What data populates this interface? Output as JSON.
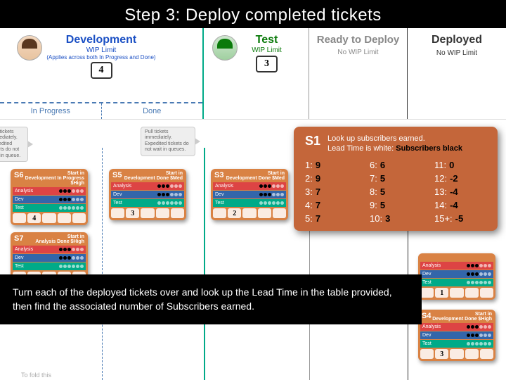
{
  "title": "Step 3: Deploy completed tickets",
  "columns": {
    "dev": {
      "title": "Development",
      "wip_label": "WIP Limit",
      "wip_sub": "(Applies across both In Progress and Done)",
      "wip_value": "4",
      "sub_left": "In Progress",
      "sub_right": "Done"
    },
    "test": {
      "title": "Test",
      "wip_label": "WIP Limit",
      "wip_value": "3"
    },
    "ready": {
      "title": "Ready to Deploy",
      "no_wip": "No WIP Limit"
    },
    "deployed": {
      "title": "Deployed",
      "no_wip": "No WIP Limit"
    }
  },
  "hints": {
    "left": "Pull tickets immediately. Expedited tickets do not wait in queue.",
    "mid": "Pull tickets immediately. Expedited tickets do not wait in queues."
  },
  "tickets": {
    "s6": {
      "id": "S6",
      "meta_top": "Start in",
      "meta_loc": "Development In Progress",
      "price": "$High",
      "footer": [
        "",
        "4",
        "",
        "",
        ""
      ]
    },
    "s7": {
      "id": "S7",
      "meta_top": "Start in",
      "meta_loc": "Analysis Done",
      "price": "$High",
      "footer": [
        "",
        "",
        "",
        "",
        ""
      ]
    },
    "s5": {
      "id": "S5",
      "meta_top": "Start in",
      "meta_loc": "Development Done",
      "price": "$Med",
      "footer": [
        "",
        "3",
        "",
        "",
        ""
      ]
    },
    "s3": {
      "id": "S3",
      "meta_top": "Start in",
      "meta_loc": "Development Done",
      "price": "$Med",
      "footer": [
        "",
        "2",
        "",
        "",
        ""
      ]
    },
    "s_deploy1": {
      "id": "",
      "meta_loc": "",
      "price": "",
      "footer": [
        "",
        "1",
        "",
        "",
        ""
      ]
    },
    "s4": {
      "id": "S4",
      "meta_top": "Start in",
      "meta_loc": "Development Done",
      "price": "$High",
      "footer": [
        "",
        "3",
        "",
        "",
        ""
      ]
    }
  },
  "row_labels": {
    "analysis": "Analysis",
    "dev": "Dev",
    "test": "Test"
  },
  "lookup": {
    "id": "S1",
    "line1": "Look up subscribers earned.",
    "line2_a": "Lead Time is white: ",
    "line2_b": "Subscribers black",
    "rows": [
      {
        "k": "1:",
        "v": "9"
      },
      {
        "k": "6:",
        "v": "6"
      },
      {
        "k": "11:",
        "v": "0"
      },
      {
        "k": "2:",
        "v": "9"
      },
      {
        "k": "7:",
        "v": "5"
      },
      {
        "k": "12:",
        "v": "-2"
      },
      {
        "k": "3:",
        "v": "7"
      },
      {
        "k": "8:",
        "v": "5"
      },
      {
        "k": "13:",
        "v": "-4"
      },
      {
        "k": "4:",
        "v": "7"
      },
      {
        "k": "9:",
        "v": "5"
      },
      {
        "k": "14:",
        "v": "-4"
      },
      {
        "k": "5:",
        "v": "7"
      },
      {
        "k": "10:",
        "v": "3"
      },
      {
        "k": "15+:",
        "v": "-5"
      }
    ]
  },
  "caption": "Turn each of the deployed tickets over and look up the Lead Time in the table provided, then find the associated number of Subscribers earned.",
  "fold": "To fold this"
}
